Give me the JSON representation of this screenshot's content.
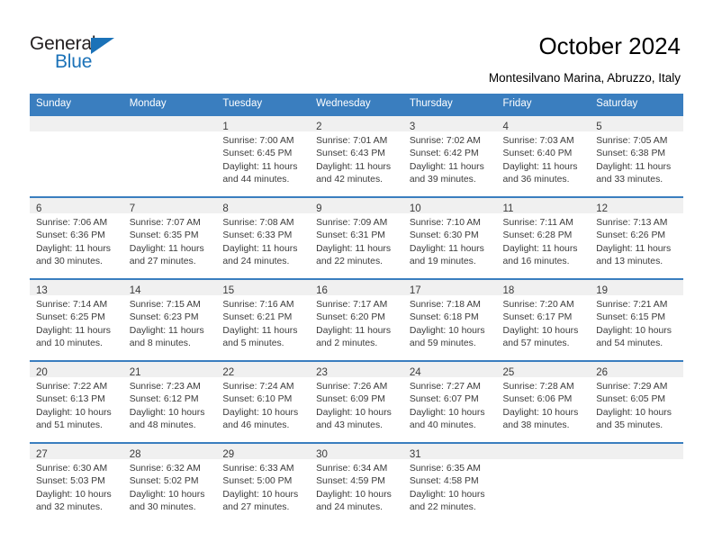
{
  "brand": {
    "name_top": "General",
    "name_bottom": "Blue",
    "accent_color": "#1b72b8"
  },
  "header": {
    "title": "October 2024",
    "subtitle": "Montesilvano Marina, Abruzzo, Italy"
  },
  "calendar": {
    "header_bg": "#3a7ebf",
    "date_band_bg": "#f0f0f0",
    "weekday_headers": [
      "Sunday",
      "Monday",
      "Tuesday",
      "Wednesday",
      "Thursday",
      "Friday",
      "Saturday"
    ],
    "weeks": [
      [
        {
          "date": "",
          "lines": []
        },
        {
          "date": "",
          "lines": []
        },
        {
          "date": "1",
          "lines": [
            "Sunrise: 7:00 AM",
            "Sunset: 6:45 PM",
            "Daylight: 11 hours",
            "and 44 minutes."
          ]
        },
        {
          "date": "2",
          "lines": [
            "Sunrise: 7:01 AM",
            "Sunset: 6:43 PM",
            "Daylight: 11 hours",
            "and 42 minutes."
          ]
        },
        {
          "date": "3",
          "lines": [
            "Sunrise: 7:02 AM",
            "Sunset: 6:42 PM",
            "Daylight: 11 hours",
            "and 39 minutes."
          ]
        },
        {
          "date": "4",
          "lines": [
            "Sunrise: 7:03 AM",
            "Sunset: 6:40 PM",
            "Daylight: 11 hours",
            "and 36 minutes."
          ]
        },
        {
          "date": "5",
          "lines": [
            "Sunrise: 7:05 AM",
            "Sunset: 6:38 PM",
            "Daylight: 11 hours",
            "and 33 minutes."
          ]
        }
      ],
      [
        {
          "date": "6",
          "lines": [
            "Sunrise: 7:06 AM",
            "Sunset: 6:36 PM",
            "Daylight: 11 hours",
            "and 30 minutes."
          ]
        },
        {
          "date": "7",
          "lines": [
            "Sunrise: 7:07 AM",
            "Sunset: 6:35 PM",
            "Daylight: 11 hours",
            "and 27 minutes."
          ]
        },
        {
          "date": "8",
          "lines": [
            "Sunrise: 7:08 AM",
            "Sunset: 6:33 PM",
            "Daylight: 11 hours",
            "and 24 minutes."
          ]
        },
        {
          "date": "9",
          "lines": [
            "Sunrise: 7:09 AM",
            "Sunset: 6:31 PM",
            "Daylight: 11 hours",
            "and 22 minutes."
          ]
        },
        {
          "date": "10",
          "lines": [
            "Sunrise: 7:10 AM",
            "Sunset: 6:30 PM",
            "Daylight: 11 hours",
            "and 19 minutes."
          ]
        },
        {
          "date": "11",
          "lines": [
            "Sunrise: 7:11 AM",
            "Sunset: 6:28 PM",
            "Daylight: 11 hours",
            "and 16 minutes."
          ]
        },
        {
          "date": "12",
          "lines": [
            "Sunrise: 7:13 AM",
            "Sunset: 6:26 PM",
            "Daylight: 11 hours",
            "and 13 minutes."
          ]
        }
      ],
      [
        {
          "date": "13",
          "lines": [
            "Sunrise: 7:14 AM",
            "Sunset: 6:25 PM",
            "Daylight: 11 hours",
            "and 10 minutes."
          ]
        },
        {
          "date": "14",
          "lines": [
            "Sunrise: 7:15 AM",
            "Sunset: 6:23 PM",
            "Daylight: 11 hours",
            "and 8 minutes."
          ]
        },
        {
          "date": "15",
          "lines": [
            "Sunrise: 7:16 AM",
            "Sunset: 6:21 PM",
            "Daylight: 11 hours",
            "and 5 minutes."
          ]
        },
        {
          "date": "16",
          "lines": [
            "Sunrise: 7:17 AM",
            "Sunset: 6:20 PM",
            "Daylight: 11 hours",
            "and 2 minutes."
          ]
        },
        {
          "date": "17",
          "lines": [
            "Sunrise: 7:18 AM",
            "Sunset: 6:18 PM",
            "Daylight: 10 hours",
            "and 59 minutes."
          ]
        },
        {
          "date": "18",
          "lines": [
            "Sunrise: 7:20 AM",
            "Sunset: 6:17 PM",
            "Daylight: 10 hours",
            "and 57 minutes."
          ]
        },
        {
          "date": "19",
          "lines": [
            "Sunrise: 7:21 AM",
            "Sunset: 6:15 PM",
            "Daylight: 10 hours",
            "and 54 minutes."
          ]
        }
      ],
      [
        {
          "date": "20",
          "lines": [
            "Sunrise: 7:22 AM",
            "Sunset: 6:13 PM",
            "Daylight: 10 hours",
            "and 51 minutes."
          ]
        },
        {
          "date": "21",
          "lines": [
            "Sunrise: 7:23 AM",
            "Sunset: 6:12 PM",
            "Daylight: 10 hours",
            "and 48 minutes."
          ]
        },
        {
          "date": "22",
          "lines": [
            "Sunrise: 7:24 AM",
            "Sunset: 6:10 PM",
            "Daylight: 10 hours",
            "and 46 minutes."
          ]
        },
        {
          "date": "23",
          "lines": [
            "Sunrise: 7:26 AM",
            "Sunset: 6:09 PM",
            "Daylight: 10 hours",
            "and 43 minutes."
          ]
        },
        {
          "date": "24",
          "lines": [
            "Sunrise: 7:27 AM",
            "Sunset: 6:07 PM",
            "Daylight: 10 hours",
            "and 40 minutes."
          ]
        },
        {
          "date": "25",
          "lines": [
            "Sunrise: 7:28 AM",
            "Sunset: 6:06 PM",
            "Daylight: 10 hours",
            "and 38 minutes."
          ]
        },
        {
          "date": "26",
          "lines": [
            "Sunrise: 7:29 AM",
            "Sunset: 6:05 PM",
            "Daylight: 10 hours",
            "and 35 minutes."
          ]
        }
      ],
      [
        {
          "date": "27",
          "lines": [
            "Sunrise: 6:30 AM",
            "Sunset: 5:03 PM",
            "Daylight: 10 hours",
            "and 32 minutes."
          ]
        },
        {
          "date": "28",
          "lines": [
            "Sunrise: 6:32 AM",
            "Sunset: 5:02 PM",
            "Daylight: 10 hours",
            "and 30 minutes."
          ]
        },
        {
          "date": "29",
          "lines": [
            "Sunrise: 6:33 AM",
            "Sunset: 5:00 PM",
            "Daylight: 10 hours",
            "and 27 minutes."
          ]
        },
        {
          "date": "30",
          "lines": [
            "Sunrise: 6:34 AM",
            "Sunset: 4:59 PM",
            "Daylight: 10 hours",
            "and 24 minutes."
          ]
        },
        {
          "date": "31",
          "lines": [
            "Sunrise: 6:35 AM",
            "Sunset: 4:58 PM",
            "Daylight: 10 hours",
            "and 22 minutes."
          ]
        },
        {
          "date": "",
          "lines": []
        },
        {
          "date": "",
          "lines": []
        }
      ]
    ]
  }
}
